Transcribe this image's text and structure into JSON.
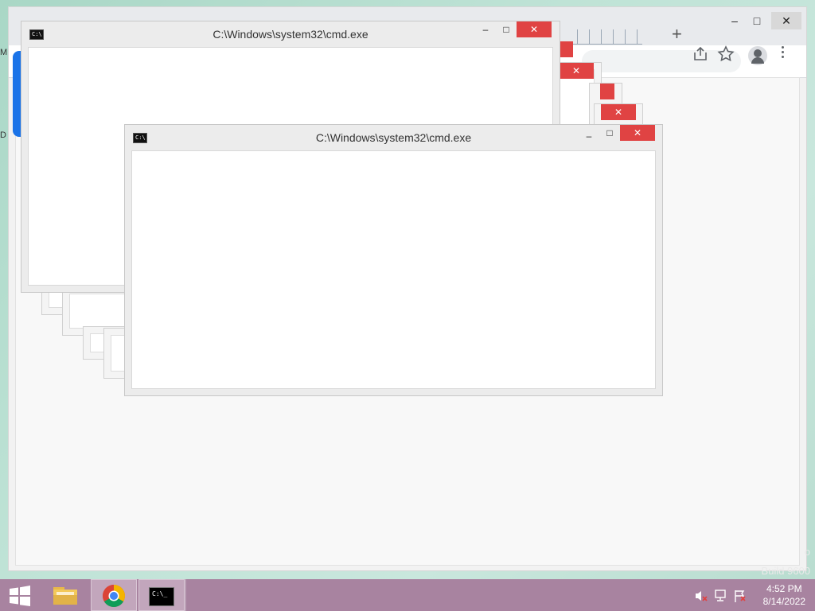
{
  "cmd_window_back": {
    "title": "C:\\Windows\\system32\\cmd.exe",
    "minimize": "–",
    "maximize": "□",
    "close": "✕"
  },
  "cmd_window_front": {
    "title": "C:\\Windows\\system32\\cmd.exe",
    "minimize": "–",
    "maximize": "□",
    "close": "✕"
  },
  "chrome": {
    "new_tab": "+",
    "minimize": "–",
    "maximize": "□",
    "close": "✕"
  },
  "ghost_windows": {
    "close_label": "✕"
  },
  "edge_letters": {
    "top": "M",
    "bottom": "D"
  },
  "watermark": {
    "line1": "o",
    "line2": "Build 9600"
  },
  "taskbar": {
    "apps": [
      {
        "name": "File Explorer",
        "icon": "folder-icon"
      },
      {
        "name": "Google Chrome",
        "icon": "chrome-icon"
      },
      {
        "name": "Command Prompt",
        "icon": "cmd-icon"
      }
    ]
  },
  "clock": {
    "time": "4:52 PM",
    "date": "8/14/2022"
  },
  "colors": {
    "close_red": "#e04343",
    "taskbar": "#a883a0",
    "desktop": "#b8dccf"
  }
}
